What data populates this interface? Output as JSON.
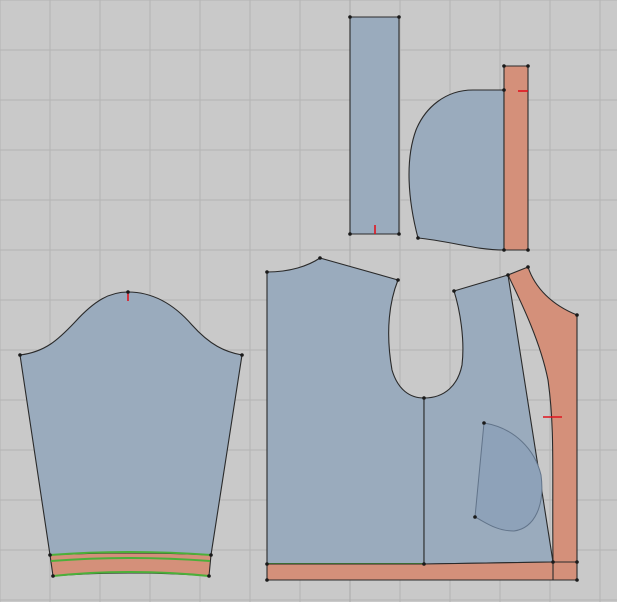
{
  "canvas": {
    "background": "#c9c9c9",
    "grid_color": "#b4b4b4"
  },
  "colors": {
    "fabric": "#9aabbd",
    "facing": "#d4907a",
    "pocket": "#8ea2b9",
    "outline": "#2a2a2a",
    "notch": "#e0141e",
    "highlight_edge": "#4caf3a"
  },
  "pieces": [
    {
      "id": "sleeve",
      "material": "fabric"
    },
    {
      "id": "sleeve-cuff",
      "material": "facing"
    },
    {
      "id": "collar-band",
      "material": "fabric"
    },
    {
      "id": "hood",
      "material": "fabric"
    },
    {
      "id": "hood-facing",
      "material": "facing"
    },
    {
      "id": "back-panel",
      "material": "fabric"
    },
    {
      "id": "front-panel",
      "material": "fabric"
    },
    {
      "id": "front-facing",
      "material": "facing"
    },
    {
      "id": "hem-band",
      "material": "facing"
    },
    {
      "id": "pocket",
      "material": "pocket"
    }
  ]
}
